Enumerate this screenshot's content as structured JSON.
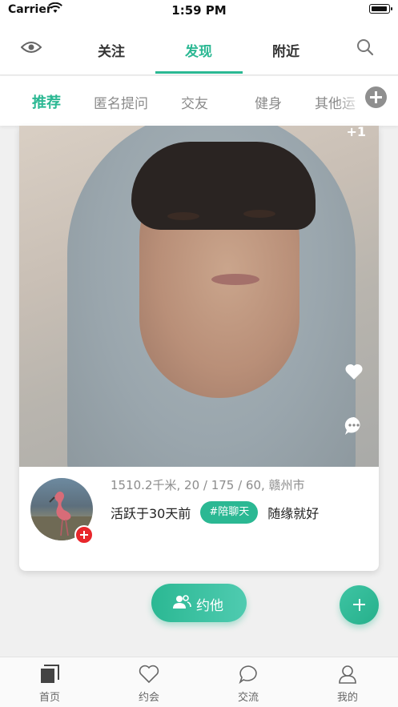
{
  "status_bar": {
    "carrier": "Carrier",
    "time": "1:59 PM"
  },
  "top_nav": {
    "tabs": [
      {
        "label": "关注"
      },
      {
        "label": "发现",
        "active": true
      },
      {
        "label": "附近"
      }
    ],
    "left_icon": "eye-icon",
    "right_icon": "search-icon",
    "accent_color": "#2bb893"
  },
  "categories": {
    "items": [
      {
        "label": "推荐",
        "active": true
      },
      {
        "label": "匿名提问"
      },
      {
        "label": "交友"
      },
      {
        "label": "健身"
      },
      {
        "label": "其他运"
      }
    ],
    "add_icon": "add-circle-icon"
  },
  "card": {
    "photo_badge": "+1",
    "distance_info": "1510.2千米, 20 / 175 / 60, 赣州市",
    "active_text": "活跃于30天前",
    "tag": "#陪聊天",
    "mood": "随缘就好",
    "like_icon": "heart-icon",
    "comment_icon": "comment-icon"
  },
  "actions": {
    "date_button": "约他"
  },
  "tabbar": {
    "items": [
      {
        "label": "首页",
        "icon": "home-icon"
      },
      {
        "label": "约会",
        "icon": "heart-outline-icon"
      },
      {
        "label": "交流",
        "icon": "chat-icon"
      },
      {
        "label": "我的",
        "icon": "profile-icon"
      }
    ]
  }
}
